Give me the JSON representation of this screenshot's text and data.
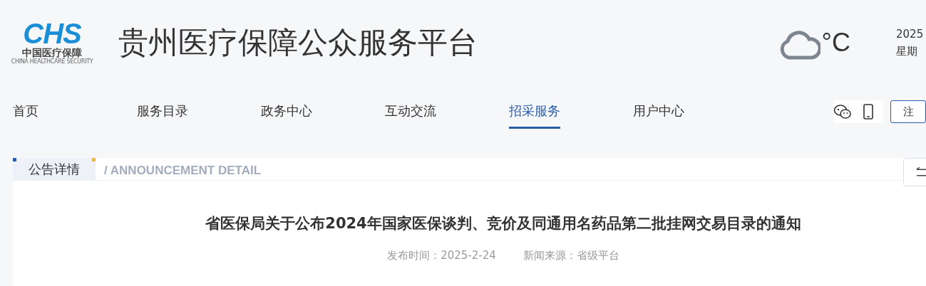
{
  "logo": {
    "mark": "CHS",
    "name": "中国医疗保障",
    "subtitle": "CHINA HEALTHCARE SECURITY"
  },
  "site_title": "贵州医疗保障公众服务平台",
  "weather": {
    "temperature": "°C"
  },
  "date": {
    "line_1": "2025",
    "line_2": "星期"
  },
  "nav": [
    {
      "label": "首页",
      "selected": false
    },
    {
      "label": "服务目录",
      "selected": false
    },
    {
      "label": "政务中心",
      "selected": false
    },
    {
      "label": "互动交流",
      "selected": false
    },
    {
      "label": "招采服务",
      "selected": true
    },
    {
      "label": "用户中心",
      "selected": false
    }
  ],
  "register_button": "注",
  "section": {
    "tab": "公告详情",
    "subtitle": "/ ANNOUNCEMENT DETAIL"
  },
  "article": {
    "title": "省医保局关于公布2024年国家医保谈判、竞价及同通用名药品第二批挂网交易目录的通知",
    "published": "发布时间：2025-2-24",
    "source": "新闻来源：省级平台"
  }
}
